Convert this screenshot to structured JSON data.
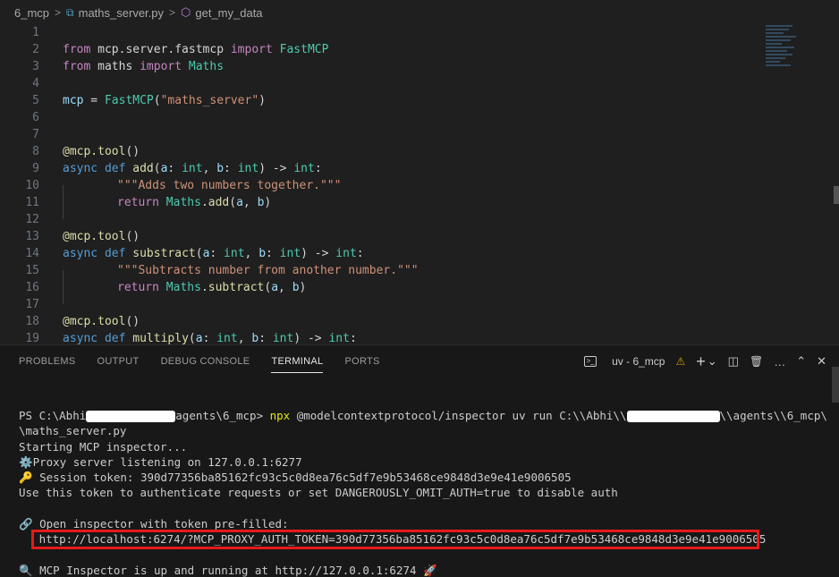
{
  "breadcrumb": {
    "folder": "6_mcp",
    "file": "maths_server.py",
    "symbol": "get_my_data"
  },
  "editor": {
    "line_numbers": [
      "1",
      "2",
      "3",
      "4",
      "5",
      "6",
      "7",
      "8",
      "9",
      "10",
      "11",
      "12",
      "13",
      "14",
      "15",
      "16",
      "17",
      "18",
      "19"
    ],
    "code": {
      "l2": {
        "a": "from",
        "b": " mcp.server.fastmcp ",
        "c": "import",
        "d": " FastMCP"
      },
      "l3": {
        "a": "from",
        "b": " maths ",
        "c": "import",
        "d": " Maths"
      },
      "l5": {
        "a": "mcp",
        "b": " = ",
        "c": "FastMCP",
        "d": "(",
        "e": "\"maths_server\"",
        "f": ")"
      },
      "l8": {
        "a": "@mcp.tool",
        "b": "()"
      },
      "l9": {
        "a": "async",
        "b": " ",
        "c": "def",
        "d": " ",
        "e": "add",
        "f": "(",
        "g": "a",
        "h": ": ",
        "i": "int",
        "j": ", ",
        "k": "b",
        "l": ": ",
        "m": "int",
        "n": ") -> ",
        "o": "int",
        "p": ":"
      },
      "l10": {
        "a": "\"\"\"Adds two numbers together.\"\"\""
      },
      "l11": {
        "a": "return",
        "b": " ",
        "c": "Maths",
        "d": ".",
        "e": "add",
        "f": "(",
        "g": "a",
        "h": ", ",
        "i": "b",
        "j": ")"
      },
      "l13": {
        "a": "@mcp.tool",
        "b": "()"
      },
      "l14": {
        "a": "async",
        "b": " ",
        "c": "def",
        "d": " ",
        "e": "substract",
        "f": "(",
        "g": "a",
        "h": ": ",
        "i": "int",
        "j": ", ",
        "k": "b",
        "l": ": ",
        "m": "int",
        "n": ") -> ",
        "o": "int",
        "p": ":"
      },
      "l15": {
        "a": "\"\"\"Subtracts number from another number.\"\"\""
      },
      "l16": {
        "a": "return",
        "b": " ",
        "c": "Maths",
        "d": ".",
        "e": "subtract",
        "f": "(",
        "g": "a",
        "h": ", ",
        "i": "b",
        "j": ")"
      },
      "l18": {
        "a": "@mcp.tool",
        "b": "()"
      },
      "l19": {
        "a": "async",
        "b": " ",
        "c": "def",
        "d": " ",
        "e": "multiply",
        "f": "(",
        "g": "a",
        "h": ": ",
        "i": "int",
        "j": ", ",
        "k": "b",
        "l": ": ",
        "m": "int",
        "n": ") -> ",
        "o": "int",
        "p": ":"
      }
    }
  },
  "panel": {
    "tabs": [
      "PROBLEMS",
      "OUTPUT",
      "DEBUG CONSOLE",
      "TERMINAL",
      "PORTS"
    ],
    "active_tab": "TERMINAL",
    "terminal_name": "uv - 6_mcp",
    "actions": {
      "warning": "⚠",
      "add": "+",
      "dropdown": "⌄",
      "split": "◫",
      "trash": "🗑",
      "more": "…",
      "maximize": "⌃",
      "close": "✕"
    }
  },
  "terminal": {
    "l1a": "PS C:\\Abhi",
    "l1b": "agents\\6_mcp> ",
    "l1cmd": "npx",
    "l1c": " @modelcontextprotocol/inspector uv run C:\\\\Abhi\\\\",
    "l1d": "\\\\agents\\\\6_mcp\\",
    "l2": "\\maths_server.py",
    "l3": "Starting MCP inspector...",
    "l4": "⚙️Proxy server listening on 127.0.0.1:6277",
    "l5": "🔑 Session token: 390d77356ba85162fc93c5c0d8ea76c5df7e9b53468ce9848d3e9e41e9006505",
    "l6": "Use this token to authenticate requests or set DANGEROUSLY_OMIT_AUTH=true to disable auth",
    "l8": "🔗 Open inspector with token pre-filled:",
    "l9": "   http://localhost:6274/?MCP_PROXY_AUTH_TOKEN=390d77356ba85162fc93c5c0d8ea76c5df7e9b53468ce9848d3e9e41e9006505",
    "l11": "🔍 MCP Inspector is up and running at http://127.0.0.1:6274 🚀"
  },
  "colors": {
    "highlight_box": "#e51a1a",
    "keyword": "#569cd6",
    "control": "#c586c0",
    "class": "#4ec9b0",
    "function": "#dcdcaa",
    "string": "#ce9178",
    "variable": "#9cdcfe"
  }
}
